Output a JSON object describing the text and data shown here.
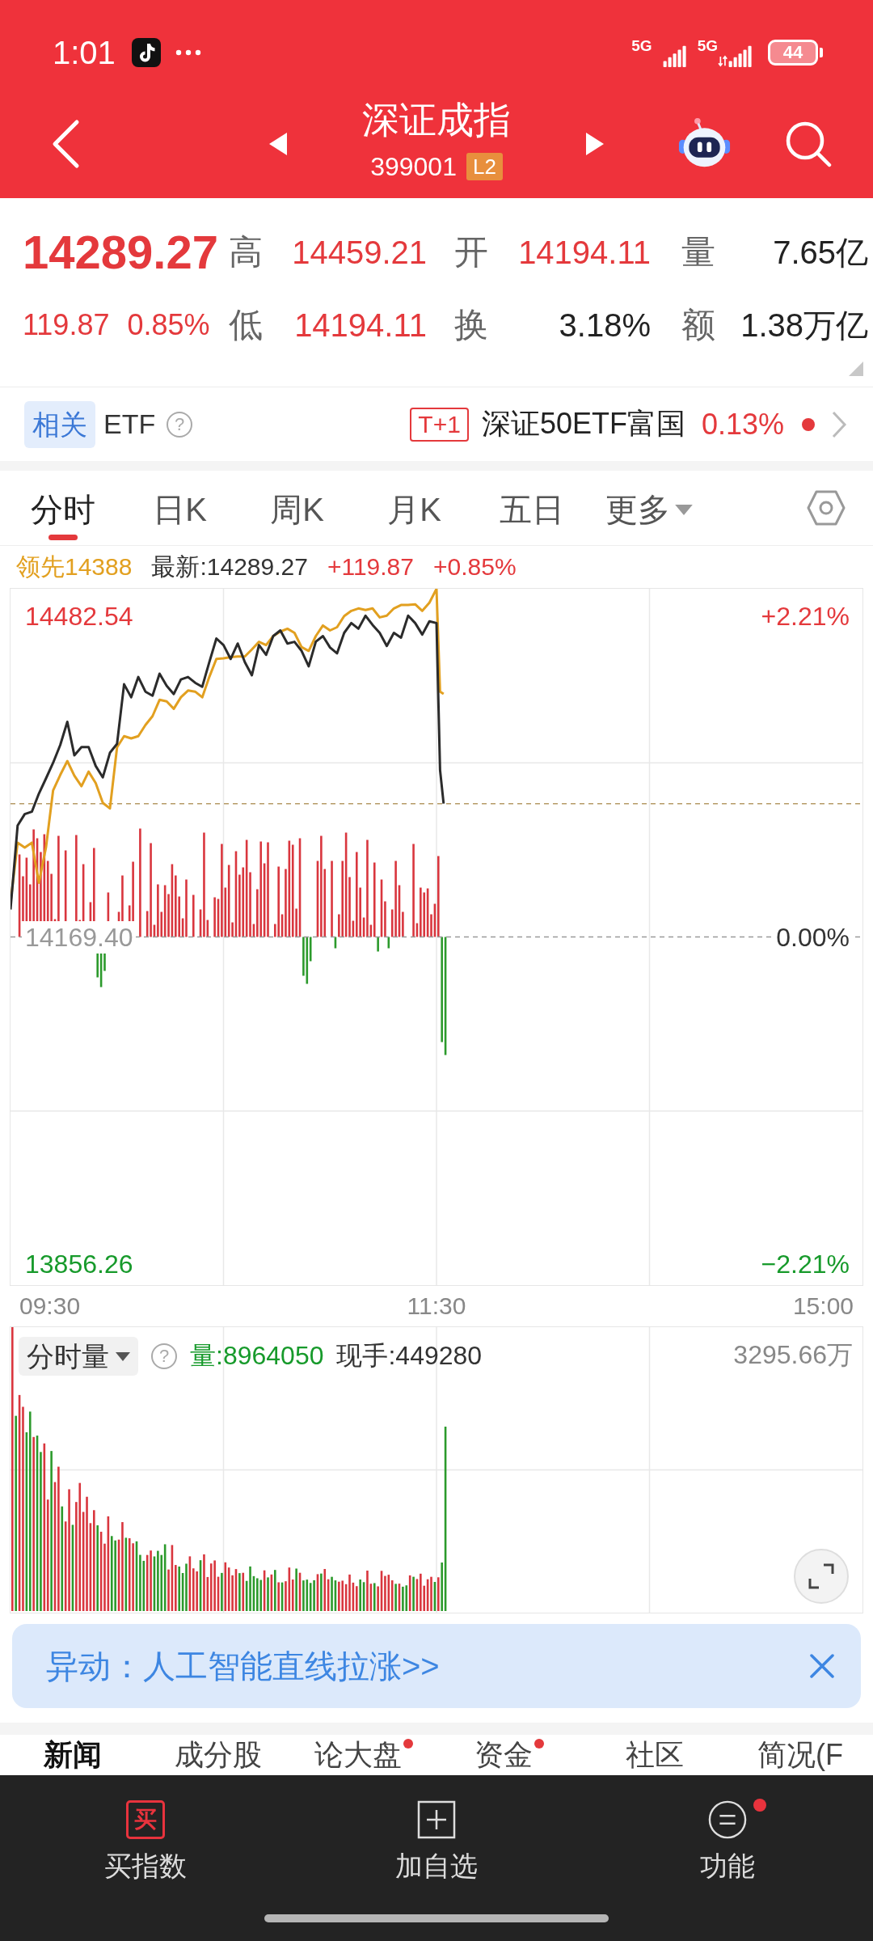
{
  "status_bar": {
    "time": "1:01",
    "signals": [
      {
        "label": "5G",
        "kind": "plain"
      },
      {
        "label": "5G",
        "kind": "data"
      }
    ],
    "battery": "44"
  },
  "header": {
    "title": "深证成指",
    "code": "399001",
    "badge": "L2"
  },
  "quote": {
    "price": "14289.27",
    "change": "119.87",
    "change_pct": "0.85%",
    "fields": [
      {
        "label": "高",
        "value": "14459.21",
        "color": "#e4393c"
      },
      {
        "label": "开",
        "value": "14194.11",
        "color": "#e4393c"
      },
      {
        "label": "量",
        "value": "7.65亿",
        "color": "#222222"
      },
      {
        "label": "低",
        "value": "14194.11",
        "color": "#e4393c"
      },
      {
        "label": "换",
        "value": "3.18%",
        "color": "#222222"
      },
      {
        "label": "额",
        "value": "1.38万亿",
        "color": "#222222"
      }
    ]
  },
  "related": {
    "tag": "相关",
    "label": "ETF",
    "help": "?",
    "badge": "T+1",
    "fund": "深证50ETF富国",
    "fund_change": "0.13%",
    "live": true
  },
  "chart_tabs": [
    {
      "label": "分时",
      "selected": true,
      "kind": "period"
    },
    {
      "label": "日K",
      "selected": false,
      "kind": "period"
    },
    {
      "label": "周K",
      "selected": false,
      "kind": "period"
    },
    {
      "label": "月K",
      "selected": false,
      "kind": "period"
    },
    {
      "label": "五日",
      "selected": false,
      "kind": "period"
    },
    {
      "label": "更多",
      "selected": false,
      "kind": "menu"
    }
  ],
  "legend": {
    "lead": "领先14388",
    "latest": "最新:14289.27",
    "change": "+119.87",
    "change_pct": "+0.85%"
  },
  "price_chart": {
    "price_labels": [
      {
        "text": "14482.54",
        "color": "#e4393c"
      },
      {
        "text": "14169.40",
        "color": "#999999"
      },
      {
        "text": "13856.26",
        "color": "#179a2b"
      }
    ],
    "percent_labels": [
      {
        "text": "+2.21%",
        "color": "#e4393c"
      },
      {
        "text": "0.00%",
        "color": "#333333"
      },
      {
        "text": "−2.21%",
        "color": "#179a2b"
      }
    ],
    "time_labels": [
      "09:30",
      "11:30",
      "15:00"
    ]
  },
  "volume": {
    "mode": "分时量",
    "help": "?",
    "amount": "量:8964050",
    "current": "现手:449280",
    "max": "3295.66万"
  },
  "alert": {
    "text": "异动：人工智能直线拉涨>>"
  },
  "news_tabs": [
    {
      "label": "新闻",
      "selected": true,
      "dot": false
    },
    {
      "label": "成分股",
      "selected": false,
      "dot": false
    },
    {
      "label": "论大盘",
      "selected": false,
      "dot": true
    },
    {
      "label": "资金",
      "selected": false,
      "dot": true
    },
    {
      "label": "社区",
      "selected": false,
      "dot": false
    },
    {
      "label": "简况(F",
      "selected": false,
      "dot": false
    }
  ],
  "bottom_nav": [
    {
      "label": "买指数",
      "kind": "buy",
      "icon_text": "买",
      "dot": false
    },
    {
      "label": "加自选",
      "kind": "add",
      "dot": false
    },
    {
      "label": "功能",
      "kind": "functions",
      "dot": true
    }
  ]
}
